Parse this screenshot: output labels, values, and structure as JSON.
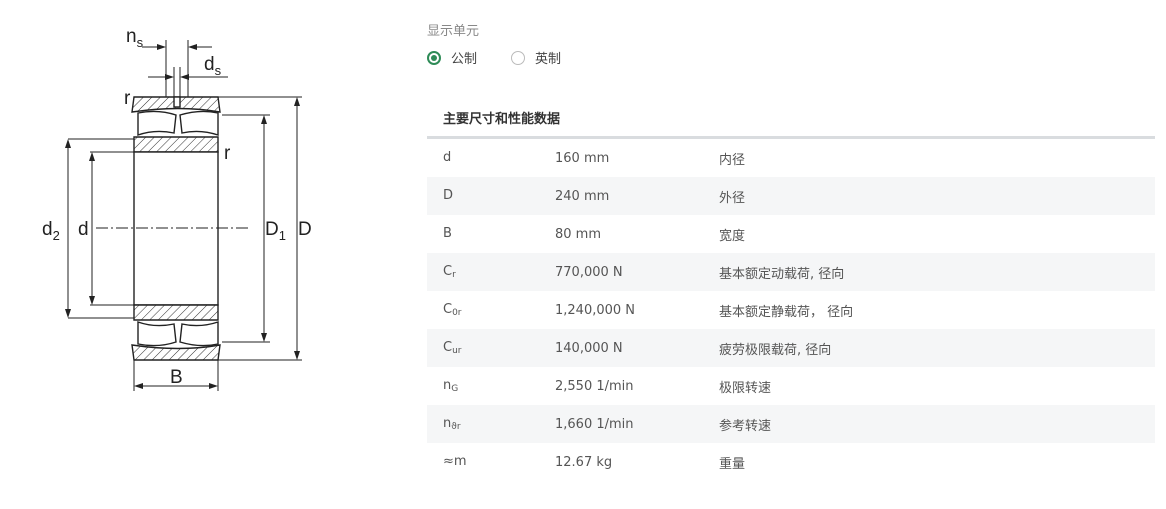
{
  "diagram": {
    "labels": {
      "ns": "n",
      "ns_sub": "s",
      "ds": "d",
      "ds_sub": "s",
      "r": "r",
      "d2": "d",
      "d2_sub": "2",
      "d": "d",
      "D1": "D",
      "D1_sub": "1",
      "D": "D",
      "B": "B"
    }
  },
  "units": {
    "label": "显示单元",
    "options": [
      {
        "label": "公制",
        "selected": true
      },
      {
        "label": "英制",
        "selected": false
      }
    ]
  },
  "section": {
    "title": "主要尺寸和性能数据"
  },
  "rows": [
    {
      "sym": "d",
      "sub": "",
      "value": "160 mm",
      "desc": "内径"
    },
    {
      "sym": "D",
      "sub": "",
      "value": "240 mm",
      "desc": "外径"
    },
    {
      "sym": "B",
      "sub": "",
      "value": "80 mm",
      "desc": "宽度"
    },
    {
      "sym": "C",
      "sub": "r",
      "value": "770,000 N",
      "desc": "基本额定动载荷, 径向"
    },
    {
      "sym": "C",
      "sub": "0r",
      "value": "1,240,000 N",
      "desc": "基本额定静载荷， 径向"
    },
    {
      "sym": "C",
      "sub": "ur",
      "value": "140,000 N",
      "desc": "疲劳极限载荷, 径向"
    },
    {
      "sym": "n",
      "sub": "G",
      "value": "2,550 1/min",
      "desc": "极限转速"
    },
    {
      "sym": "n",
      "sub": "ϑr",
      "value": "1,660 1/min",
      "desc": "参考转速"
    },
    {
      "sym": "≈m",
      "sub": "",
      "value": "12.67 kg",
      "desc": "重量"
    }
  ]
}
